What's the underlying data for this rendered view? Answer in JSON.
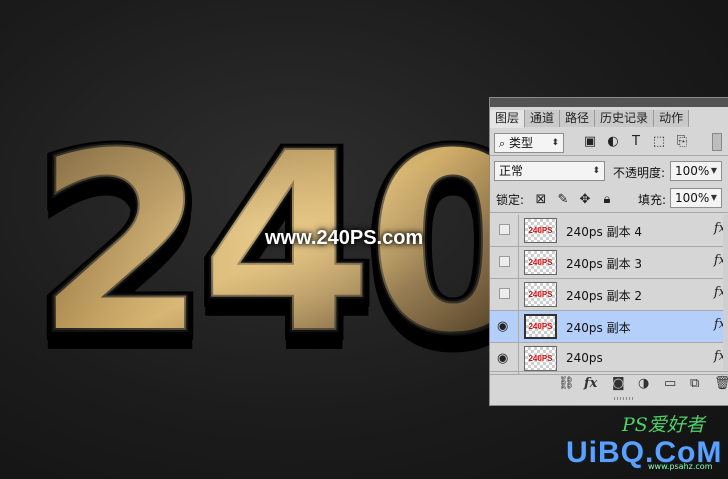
{
  "artwork": {
    "big_text": "240",
    "watermark": "www.240PS.com",
    "site_logo": "UiBQ.CoM",
    "site_logo_cn": "PS爱好者",
    "site_logo_sub": "www.psahz.com"
  },
  "layers_panel": {
    "tabs": [
      {
        "label": "图层",
        "active": true
      },
      {
        "label": "通道",
        "active": false
      },
      {
        "label": "路径",
        "active": false
      },
      {
        "label": "历史记录",
        "active": false
      },
      {
        "label": "动作",
        "active": false
      }
    ],
    "filter": {
      "label": "类型",
      "icon": "search-icon"
    },
    "blend_mode": "正常",
    "opacity_label": "不透明度:",
    "opacity_value": "100%",
    "lock_label": "锁定:",
    "fill_label": "填充:",
    "fill_value": "100%",
    "layers": [
      {
        "name": "240ps 副本 4",
        "visible": false,
        "selected": false,
        "thumb_text": "240PS",
        "fx": "fx"
      },
      {
        "name": "240ps 副本 3",
        "visible": false,
        "selected": false,
        "thumb_text": "240PS",
        "fx": "fx"
      },
      {
        "name": "240ps 副本 2",
        "visible": false,
        "selected": false,
        "thumb_text": "240PS",
        "fx": "fx"
      },
      {
        "name": "240ps 副本",
        "visible": true,
        "selected": true,
        "thumb_text": "240PS",
        "fx": "fx"
      },
      {
        "name": "240ps",
        "visible": true,
        "selected": false,
        "thumb_text": "240PS",
        "fx": "fx"
      }
    ],
    "footer_icons": [
      "link-icon",
      "fx-icon",
      "mask-icon",
      "adjustment-icon",
      "folder-icon",
      "new-layer-icon",
      "trash-icon"
    ],
    "footer_fx_label": "fx"
  },
  "colors": {
    "selected_layer": "#b5cffb",
    "thumb_text": "#d01818",
    "gold_edge": "#d49a1c"
  }
}
